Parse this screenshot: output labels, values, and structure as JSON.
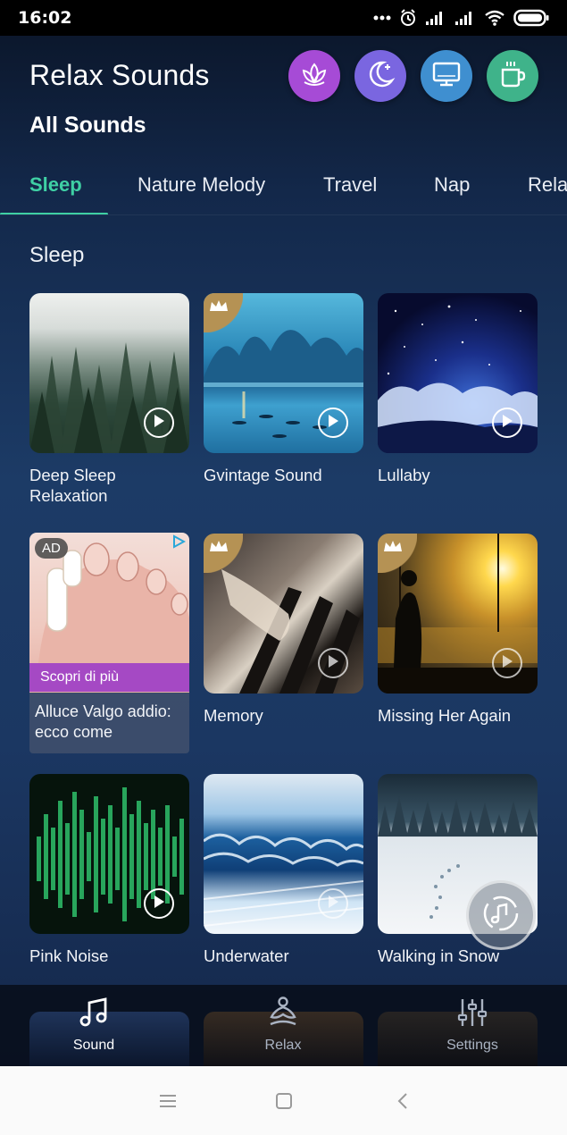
{
  "status_bar": {
    "time": "16:02",
    "icons": [
      "more-dots-icon",
      "alarm-icon",
      "signal-icon",
      "signal-icon",
      "wifi-icon",
      "battery-icon"
    ]
  },
  "header": {
    "title": "Relax Sounds",
    "subtitle": "All Sounds",
    "buttons": [
      {
        "name": "lotus-button",
        "icon": "lotus-icon",
        "color": "#a64bd6"
      },
      {
        "name": "night-button",
        "icon": "moon-icon",
        "color": "#7a66e0"
      },
      {
        "name": "screen-button",
        "icon": "monitor-icon",
        "color": "#3f8fd0"
      },
      {
        "name": "coffee-button",
        "icon": "coffee-cup-icon",
        "color": "#3fb38a"
      }
    ]
  },
  "tabs": [
    {
      "label": "Sleep",
      "active": true
    },
    {
      "label": "Nature Melody",
      "active": false
    },
    {
      "label": "Travel",
      "active": false
    },
    {
      "label": "Nap",
      "active": false
    },
    {
      "label": "Relax",
      "active": false
    }
  ],
  "colors": {
    "accent": "#3fd0a4",
    "ad_cta": "#a549c4",
    "premium_tag": "#b59254"
  },
  "section": {
    "title": "Sleep",
    "items": [
      {
        "label": "Deep Sleep Relaxation",
        "premium": false
      },
      {
        "label": "Gvintage Sound",
        "premium": true
      },
      {
        "label": "Lullaby",
        "premium": false
      },
      {
        "label": "Memory",
        "premium": true
      },
      {
        "label": "Missing Her Again",
        "premium": true
      },
      {
        "label": "Pink Noise",
        "premium": false
      },
      {
        "label": "Underwater",
        "premium": false
      },
      {
        "label": "Walking in Snow",
        "premium": false
      }
    ]
  },
  "ad": {
    "badge": "AD",
    "cta": "Scopri di più",
    "text": "Alluce Valgo addio: ecco come"
  },
  "bottom_nav": [
    {
      "label": "Sound",
      "icon": "music-note-icon",
      "active": true
    },
    {
      "label": "Relax",
      "icon": "meditation-icon",
      "active": false
    },
    {
      "label": "Settings",
      "icon": "sliders-icon",
      "active": false
    }
  ],
  "system_nav": [
    "menu-icon",
    "home-icon",
    "back-icon"
  ]
}
